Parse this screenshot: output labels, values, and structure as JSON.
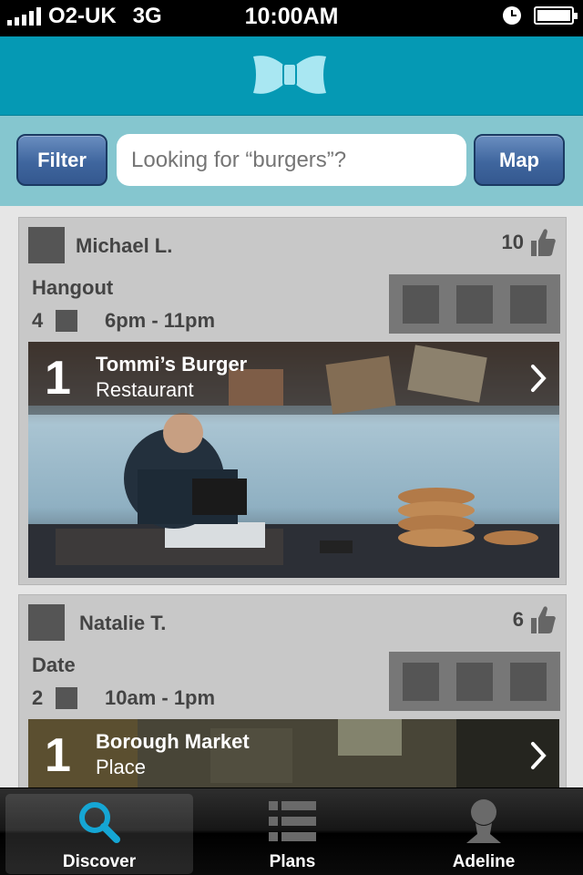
{
  "status_bar": {
    "carrier": "O2-UK",
    "network": "3G",
    "time": "10:00AM"
  },
  "search": {
    "filter_label": "Filter",
    "placeholder": "Looking for “burgers”?",
    "map_label": "Map"
  },
  "cards": [
    {
      "user": "Michael L.",
      "likes": "10",
      "plan_type": "Hangout",
      "people_count": "4",
      "time_range": "6pm - 11pm",
      "place": {
        "number": "1",
        "name": "Tommi’s Burger",
        "type": "Restaurant"
      }
    },
    {
      "user": "Natalie T.",
      "likes": "6",
      "plan_type": "Date",
      "people_count": "2",
      "time_range": "10am - 1pm",
      "place": {
        "number": "1",
        "name": "Borough Market",
        "type": "Place"
      }
    }
  ],
  "tabs": [
    {
      "label": "Discover",
      "icon": "search-icon",
      "active": true
    },
    {
      "label": "Plans",
      "icon": "list-icon",
      "active": false
    },
    {
      "label": "Adeline",
      "icon": "person-icon",
      "active": false
    }
  ],
  "colors": {
    "header": "#0599b4",
    "search_bar": "#85c6cf",
    "button": "#3f669e",
    "active_tab_icon": "#15a6d4"
  }
}
